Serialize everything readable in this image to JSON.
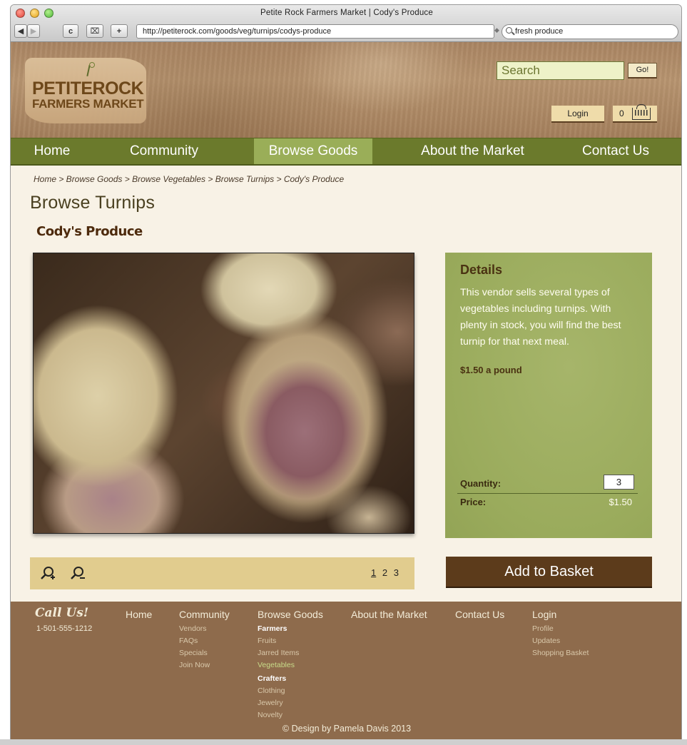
{
  "browser": {
    "window_title": "Petite Rock Farmers Market | Cody's Produce",
    "url": "http://petiterock.com/goods/veg/turnips/codys-produce",
    "search_value": "fresh produce",
    "buttons": {
      "back": "◀",
      "forward": "▶",
      "reload": "c",
      "bookmark": "⌧",
      "add": "+"
    }
  },
  "header": {
    "logo_line1": "PETITEROCK",
    "logo_line2": "FARMERS MARKET",
    "search_placeholder": "Search",
    "go_label": "Go!",
    "login_label": "Login",
    "basket_count": "0"
  },
  "nav": {
    "items": [
      {
        "label": "Home"
      },
      {
        "label": "Community"
      },
      {
        "label": "Browse Goods",
        "active": true
      },
      {
        "label": "About the Market"
      },
      {
        "label": "Contact Us"
      }
    ]
  },
  "breadcrumb": "Home > Browse Goods > Browse Vegetables > Browse Turnips > Cody's Produce",
  "page_title": "Browse Turnips",
  "vendor_name": "Cody's Produce",
  "gallery": {
    "pages": [
      "1",
      "2",
      "3"
    ],
    "current_page": "1",
    "zoom_in_icon": "zoom-in-icon",
    "zoom_out_icon": "zoom-out-icon"
  },
  "details": {
    "title": "Details",
    "description": "This vendor sells several types of vegetables including turnips. With plenty in stock, you will find the best turnip for that next meal.",
    "unit_price": "$1.50 a pound",
    "quantity_label": "Quantity:",
    "quantity_value": "3",
    "price_label": "Price:",
    "price_value": "$1.50",
    "add_button": "Add to Basket"
  },
  "footer": {
    "call_us": "Call Us!",
    "phone": "1-501-555-1212",
    "home": "Home",
    "community": {
      "title": "Community",
      "links": [
        "Vendors",
        "FAQs",
        "Specials",
        "Join Now"
      ]
    },
    "browse": {
      "title": "Browse Goods",
      "farmers_title": "Farmers",
      "farmers_links": [
        "Fruits",
        "Jarred Items",
        "Vegetables"
      ],
      "crafters_title": "Crafters",
      "crafters_links": [
        "Clothing",
        "Jewelry",
        "Novelty"
      ]
    },
    "about": "About the Market",
    "contact": "Contact Us",
    "login": {
      "title": "Login",
      "links": [
        "Profile",
        "Updates",
        "Shopping Basket"
      ]
    },
    "copyright": "© Design by Pamela Davis 2013"
  },
  "colors": {
    "nav_bg": "#6b7a2c",
    "nav_active": "#9aae58",
    "details_bg": "#9aab5c",
    "add_button_bg": "#5c3b1b",
    "footer_bg": "#8e6b4c",
    "page_bg": "#f8f2e6"
  }
}
